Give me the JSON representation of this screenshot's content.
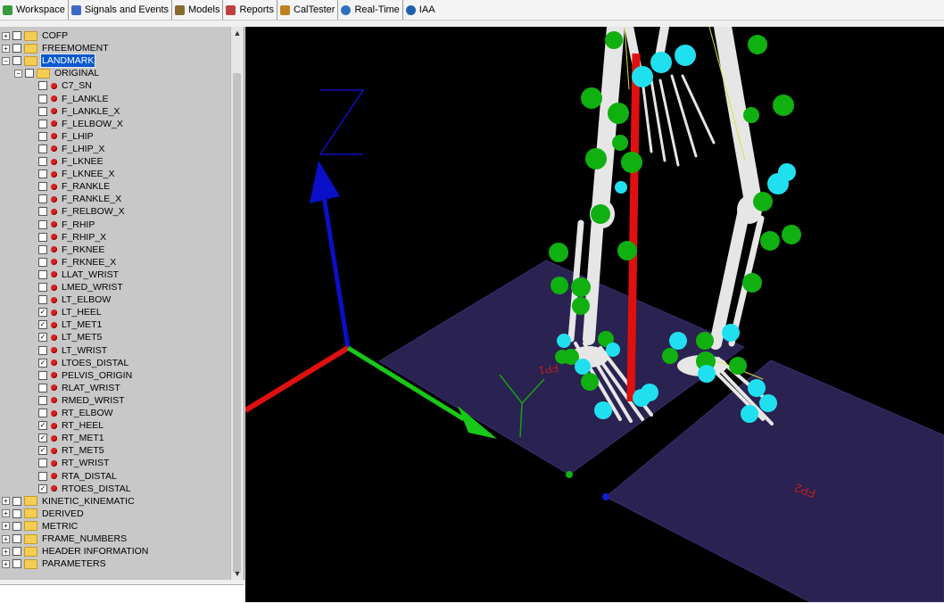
{
  "toolbar": {
    "tabs": [
      {
        "label": "Workspace",
        "icon": "workspace-icon"
      },
      {
        "label": "Signals and Events",
        "icon": "signals-icon"
      },
      {
        "label": "Models",
        "icon": "models-icon"
      },
      {
        "label": "Reports",
        "icon": "reports-icon"
      },
      {
        "label": "CalTester",
        "icon": "caltester-icon"
      },
      {
        "label": "Real-Time",
        "icon": "realtime-icon"
      },
      {
        "label": "IAA",
        "icon": "gear-icon"
      }
    ]
  },
  "tree": {
    "top_folders": [
      "COFP",
      "FREEMOMENT",
      "LANDMARK"
    ],
    "selected": "LANDMARK",
    "subfolder": "ORIGINAL",
    "landmarks": [
      {
        "name": "C7_SN",
        "checked": false
      },
      {
        "name": "F_LANKLE",
        "checked": false
      },
      {
        "name": "F_LANKLE_X",
        "checked": false
      },
      {
        "name": "F_LELBOW_X",
        "checked": false
      },
      {
        "name": "F_LHIP",
        "checked": false
      },
      {
        "name": "F_LHIP_X",
        "checked": false
      },
      {
        "name": "F_LKNEE",
        "checked": false
      },
      {
        "name": "F_LKNEE_X",
        "checked": false
      },
      {
        "name": "F_RANKLE",
        "checked": false
      },
      {
        "name": "F_RANKLE_X",
        "checked": false
      },
      {
        "name": "F_RELBOW_X",
        "checked": false
      },
      {
        "name": "F_RHIP",
        "checked": false
      },
      {
        "name": "F_RHIP_X",
        "checked": false
      },
      {
        "name": "F_RKNEE",
        "checked": false
      },
      {
        "name": "F_RKNEE_X",
        "checked": false
      },
      {
        "name": "LLAT_WRIST",
        "checked": false
      },
      {
        "name": "LMED_WRIST",
        "checked": false
      },
      {
        "name": "LT_ELBOW",
        "checked": false
      },
      {
        "name": "LT_HEEL",
        "checked": true
      },
      {
        "name": "LT_MET1",
        "checked": true
      },
      {
        "name": "LT_MET5",
        "checked": true
      },
      {
        "name": "LT_WRIST",
        "checked": false
      },
      {
        "name": "LTOES_DISTAL",
        "checked": true
      },
      {
        "name": "PELVIS_ORIGIN",
        "checked": false
      },
      {
        "name": "RLAT_WRIST",
        "checked": false
      },
      {
        "name": "RMED_WRIST",
        "checked": false
      },
      {
        "name": "RT_ELBOW",
        "checked": false
      },
      {
        "name": "RT_HEEL",
        "checked": true
      },
      {
        "name": "RT_MET1",
        "checked": true
      },
      {
        "name": "RT_MET5",
        "checked": true
      },
      {
        "name": "RT_WRIST",
        "checked": false
      },
      {
        "name": "RTA_DISTAL",
        "checked": false
      },
      {
        "name": "RTOES_DISTAL",
        "checked": true
      }
    ],
    "bottom_folders": [
      "KINETIC_KINEMATIC",
      "DERIVED",
      "METRIC",
      "FRAME_NUMBERS",
      "HEADER INFORMATION",
      "PARAMETERS"
    ]
  },
  "viewport": {
    "axis_labels": {
      "z": "Z",
      "y": "Y"
    },
    "force_plates": [
      "FP1",
      "FP2"
    ],
    "colors": {
      "background": "#000000",
      "plate": "#2a2250",
      "x_axis": "#e01010",
      "y_axis": "#18c818",
      "z_axis": "#0a10c8",
      "bone": "#e8e8e8",
      "marker_green": "#10b010",
      "marker_cyan": "#20e0f0"
    }
  }
}
